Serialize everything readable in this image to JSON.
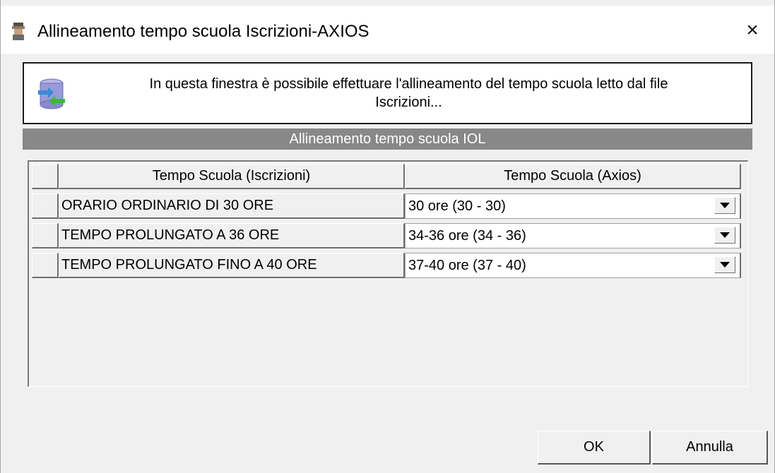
{
  "window": {
    "title": "Allineamento tempo scuola Iscrizioni-AXIOS",
    "close_symbol": "×"
  },
  "info": {
    "icon": "database-sync-icon",
    "line1": "In questa finestra è possibile effettuare l'allineamento del tempo scuola letto dal file",
    "line2": "Iscrizioni..."
  },
  "section": {
    "title": "Allineamento tempo scuola IOL"
  },
  "grid": {
    "columns": [
      "Tempo Scuola (Iscrizioni)",
      "Tempo Scuola (Axios)"
    ],
    "rows": [
      {
        "iscrizioni": "ORARIO ORDINARIO DI 30 ORE",
        "axios": "30 ore (30 - 30)"
      },
      {
        "iscrizioni": "TEMPO PROLUNGATO A 36 ORE",
        "axios": "34-36 ore (34 - 36)"
      },
      {
        "iscrizioni": "TEMPO PROLUNGATO FINO A 40 ORE",
        "axios": "37-40 ore (37 - 40)"
      }
    ]
  },
  "buttons": {
    "ok": "OK",
    "cancel": "Annulla"
  }
}
